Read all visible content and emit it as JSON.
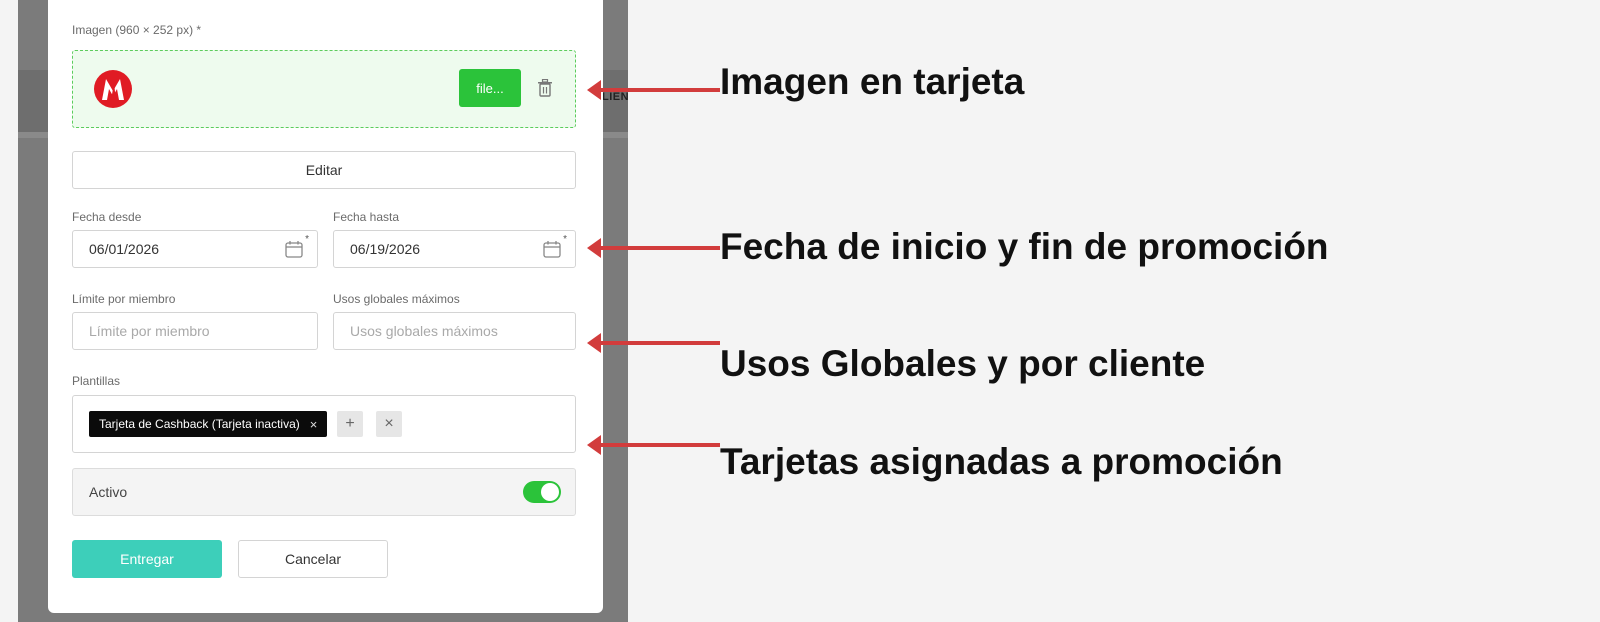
{
  "background": {
    "header_text": "LIEN"
  },
  "form": {
    "image_label": "Imagen (960 × 252 px) *",
    "file_button": "file...",
    "edit_button": "Editar",
    "date_from": {
      "label": "Fecha desde",
      "value": "06/01/2026",
      "required": "*"
    },
    "date_to": {
      "label": "Fecha hasta",
      "value": "06/19/2026",
      "required": "*"
    },
    "member_limit": {
      "label": "Límite por miembro",
      "placeholder": "Límite por miembro"
    },
    "global_uses": {
      "label": "Usos globales máximos",
      "placeholder": "Usos globales máximos"
    },
    "templates": {
      "label": "Plantillas",
      "chip": "Tarjeta de Cashback (Tarjeta inactiva)",
      "chip_remove": "×",
      "add": "+",
      "clear": "×"
    },
    "active": {
      "label": "Activo",
      "state": "on"
    },
    "submit_button": "Entregar",
    "cancel_button": "Cancelar"
  },
  "annotations": [
    "Imagen en tarjeta",
    "Fecha de inicio y fin de promoción",
    "Usos Globales y por cliente",
    "Tarjetas asignadas a promoción"
  ],
  "colors": {
    "primary_green": "#2bc33a",
    "teal": "#3dcfba",
    "arrow_red": "#d23c3c",
    "logo_red": "#e01b24"
  },
  "icons": [
    "logo-icon",
    "trash-icon",
    "calendar-icon",
    "plus-icon",
    "close-icon"
  ]
}
